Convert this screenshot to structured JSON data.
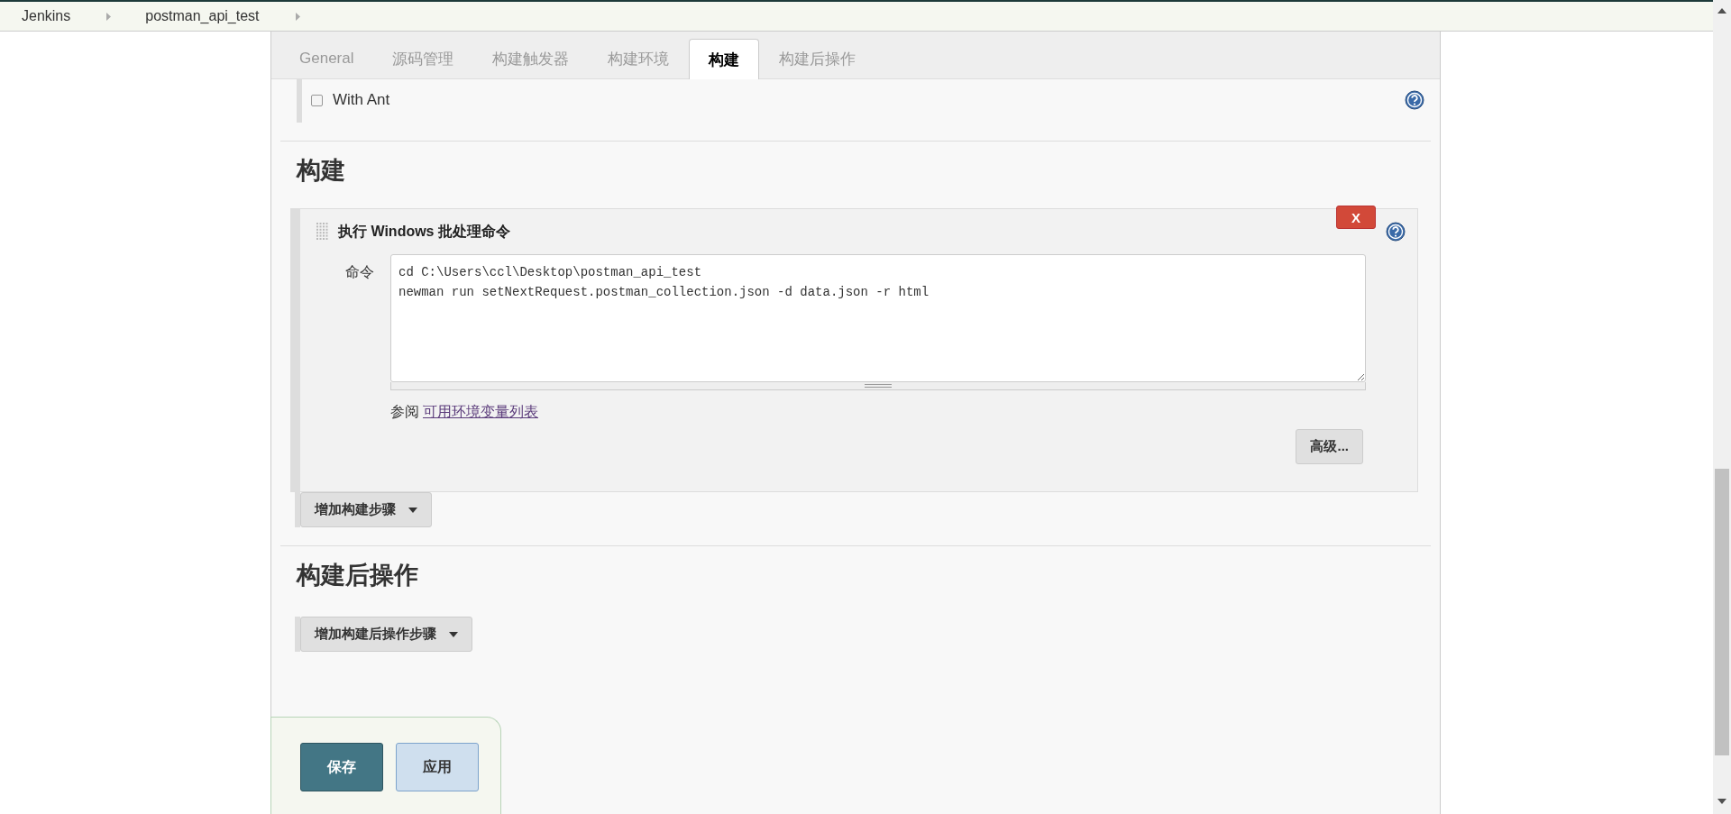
{
  "breadcrumbs": [
    {
      "label": "Jenkins"
    },
    {
      "label": "postman_api_test"
    }
  ],
  "tabs": [
    {
      "label": "General",
      "selected": false
    },
    {
      "label": "源码管理",
      "selected": false
    },
    {
      "label": "构建触发器",
      "selected": false
    },
    {
      "label": "构建环境",
      "selected": false
    },
    {
      "label": "构建",
      "selected": true
    },
    {
      "label": "构建后操作",
      "selected": false
    }
  ],
  "options": [
    {
      "label": "With Ant",
      "checked": false
    }
  ],
  "sections": [
    {
      "title": "构建",
      "steps": [
        {
          "title": "执行 Windows 批处理命令",
          "delete": "X",
          "field_label": "命令",
          "command": "cd C:\\Users\\ccl\\Desktop\\postman_api_test\nnewman run setNextRequest.postman_collection.json -d data.json -r html",
          "see_also": "参阅",
          "link": "可用环境变量列表",
          "advanced": "高级..."
        }
      ],
      "add_button": "增加构建步骤"
    },
    {
      "title": "构建后操作",
      "add_button": "增加构建后操作步骤"
    }
  ],
  "buttons": [
    {
      "label": "保存",
      "kind": "primary"
    },
    {
      "label": "应用",
      "kind": "secondary"
    }
  ]
}
